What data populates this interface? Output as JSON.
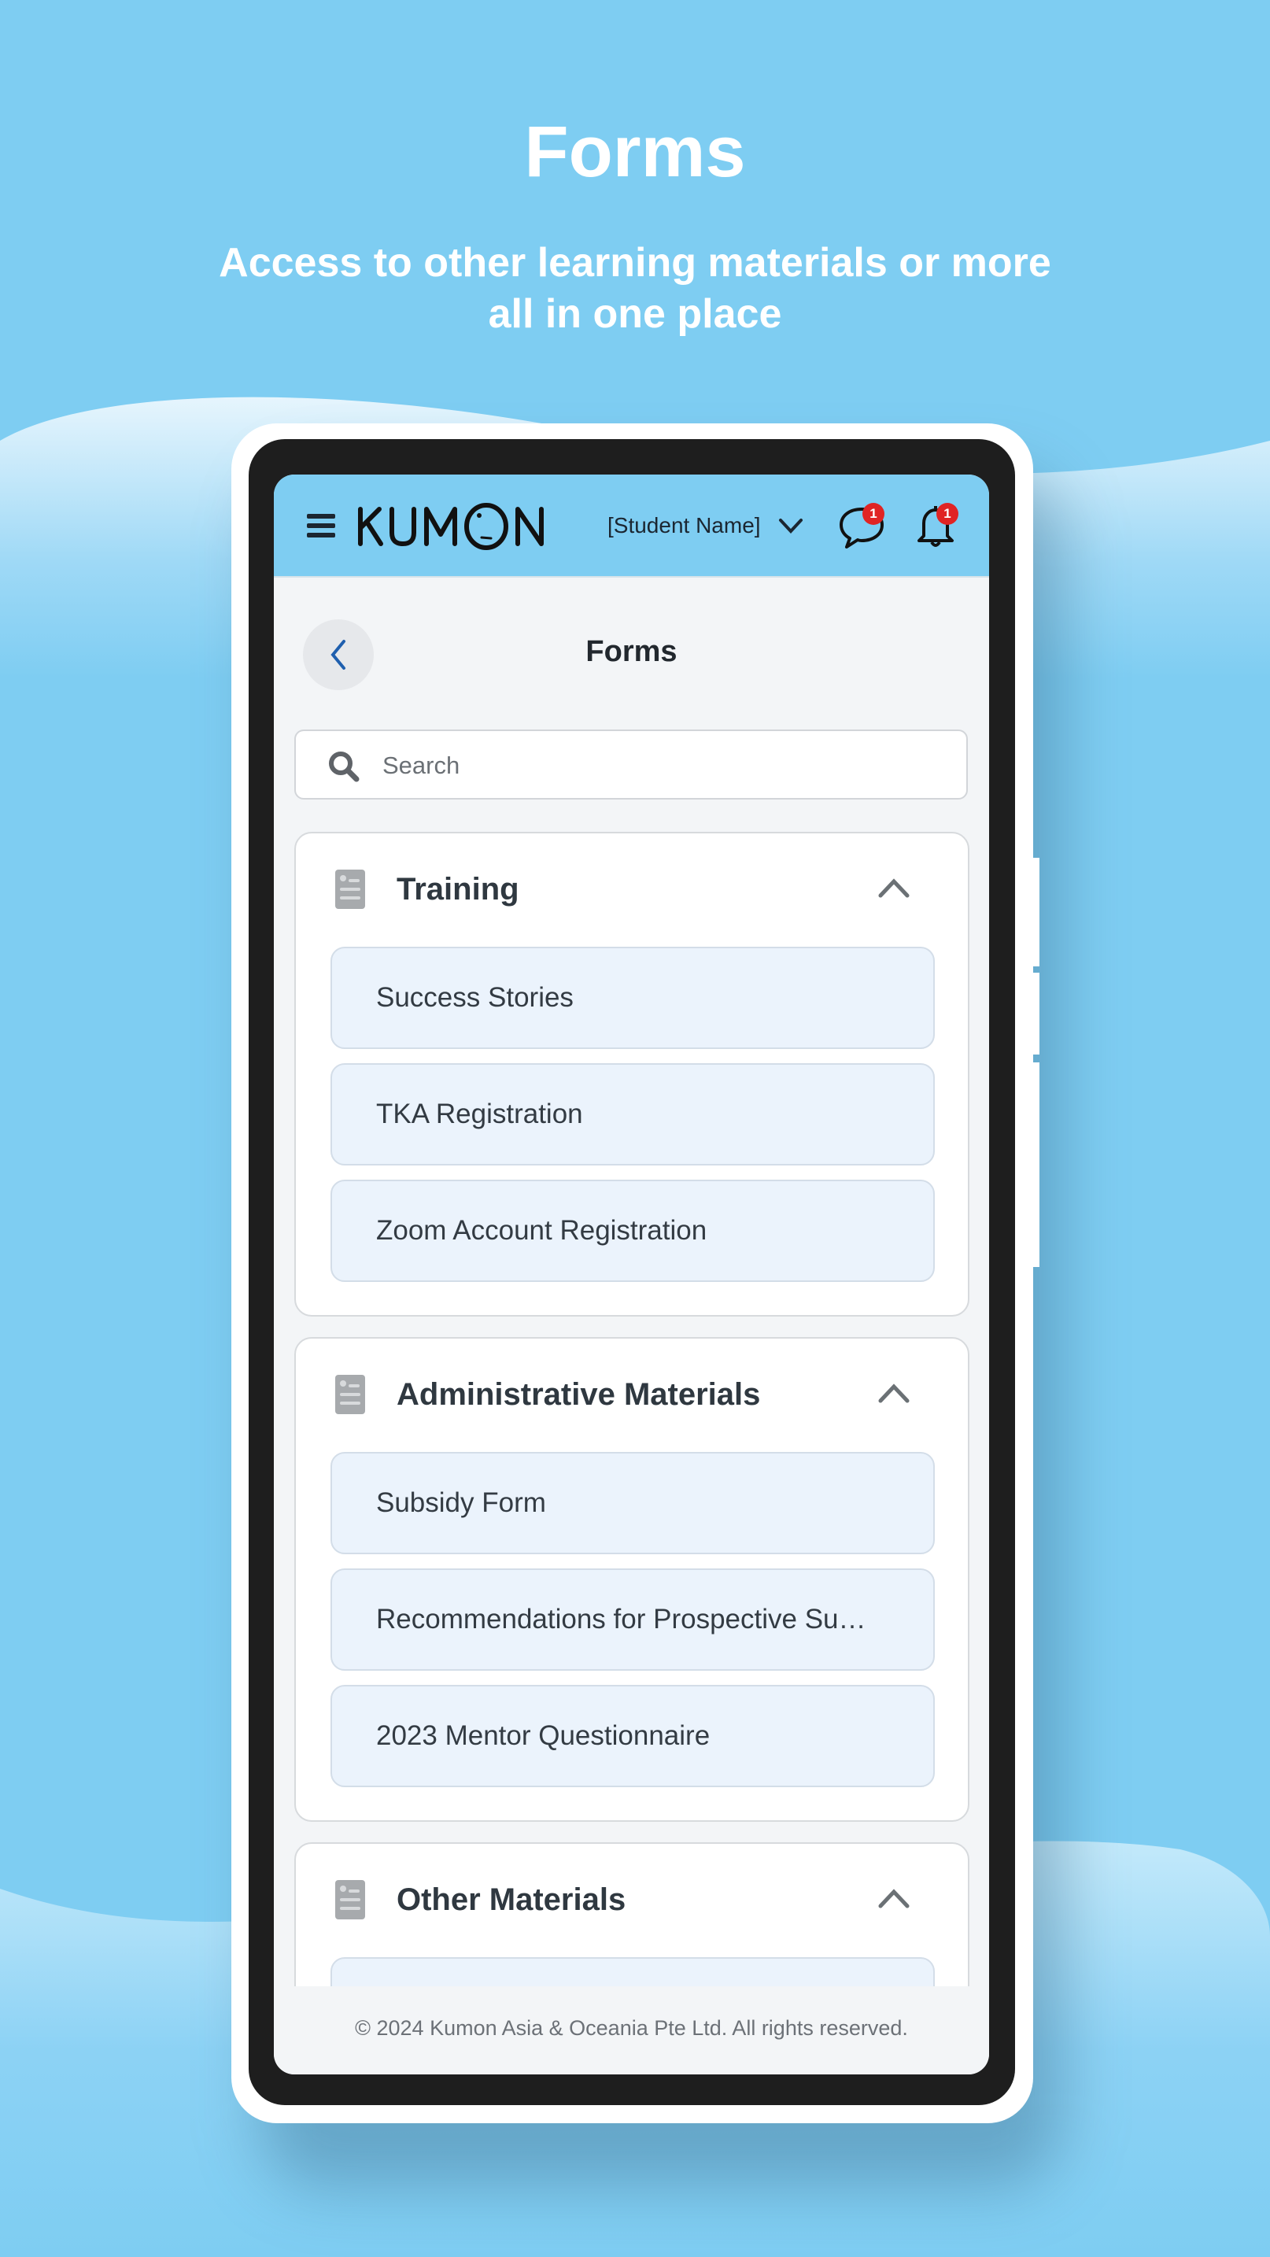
{
  "promo": {
    "title": "Forms",
    "subtitle": "Access to other learning materials or more all in one place"
  },
  "header": {
    "menu_icon": "hamburger-icon",
    "logo": "KUMON",
    "student_select": "[Student Name]",
    "messages": {
      "icon": "chat-bubble-icon",
      "badge": "1"
    },
    "notifications": {
      "icon": "bell-icon",
      "badge": "1"
    }
  },
  "page": {
    "back_icon": "chevron-left-icon",
    "title": "Forms"
  },
  "search": {
    "placeholder": "Search",
    "value": ""
  },
  "sections": [
    {
      "title": "Training",
      "icon": "document-icon",
      "expanded": true,
      "items": [
        "Success Stories",
        "TKA Registration",
        "Zoom Account Registration"
      ]
    },
    {
      "title": "Administrative Materials",
      "icon": "document-icon",
      "expanded": true,
      "items": [
        "Subsidy Form",
        "Recommendations for Prospective Su…",
        "2023 Mentor Questionnaire"
      ]
    },
    {
      "title": "Other Materials",
      "icon": "document-icon",
      "expanded": true,
      "items": [
        ""
      ]
    }
  ],
  "footer": {
    "copyright": "© 2024 Kumon Asia & Oceania Pte Ltd. All rights reserved."
  },
  "colors": {
    "background": "#7ecdf2",
    "header": "#7ecdf2",
    "badge": "#e02424",
    "back_chevron": "#1f5fae",
    "item_bg": "#ebf3fc"
  }
}
